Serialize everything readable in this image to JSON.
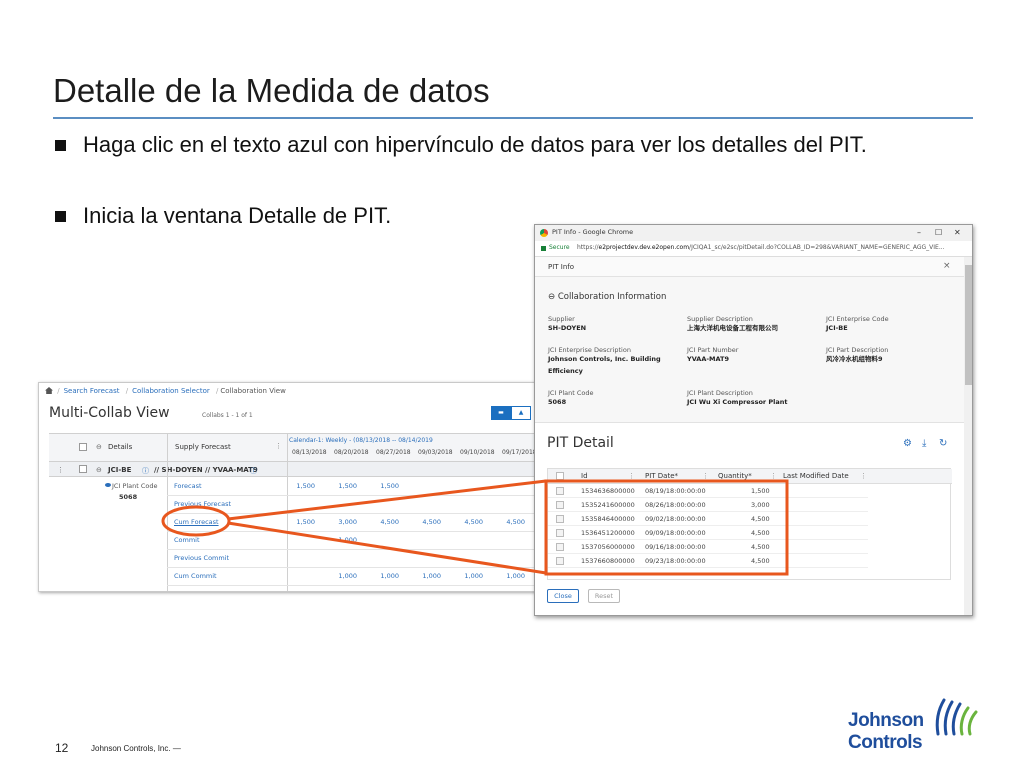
{
  "slide": {
    "title": "Detalle de la Medida de datos",
    "bullets": [
      "Haga clic en el texto azul con hipervínculo de datos para ver los detalles del PIT.",
      "Inicia la ventana Detalle de PIT."
    ],
    "page_number": "12",
    "footer_company": "Johnson Controls, Inc. —",
    "logo": {
      "line1": "Johnson",
      "line2": "Controls",
      "color": "#1f4e9c"
    }
  },
  "multi_collab": {
    "breadcrumbs": [
      "Search Forecast",
      "Collaboration Selector",
      "Collaboration View"
    ],
    "title": "Multi-Collab View",
    "collabs_count": "Collabs 1 - 1 of 1",
    "header": {
      "details": "Details",
      "supply_forecast": "Supply Forecast",
      "calendar": "Calendar-1: Weekly - (08/13/2018 -- 08/14/2019",
      "dates": [
        "08/13/2018",
        "08/20/2018",
        "08/27/2018",
        "09/03/2018",
        "09/10/2018",
        "09/17/2018"
      ]
    },
    "group": {
      "enterprise": "JCI-BE",
      "path": "// SH-DOYEN // YVAA-MAT9"
    },
    "plant": {
      "label": "JCI Plant Code",
      "code": "5068"
    },
    "rows": [
      {
        "name": "Forecast",
        "values": [
          "1,500",
          "1,500",
          "1,500",
          "",
          "",
          ""
        ]
      },
      {
        "name": "Previous Forecast",
        "values": [
          "",
          "",
          "",
          "",
          "",
          ""
        ]
      },
      {
        "name": "Cum Forecast",
        "values": [
          "1,500",
          "3,000",
          "4,500",
          "4,500",
          "4,500",
          "4,500"
        ]
      },
      {
        "name": "Commit",
        "values": [
          "",
          "1,000",
          "",
          "",
          "",
          ""
        ]
      },
      {
        "name": "Previous Commit",
        "values": [
          "",
          "",
          "",
          "",
          "",
          ""
        ]
      },
      {
        "name": "Cum Commit",
        "values": [
          "",
          "1,000",
          "1,000",
          "1,000",
          "1,000",
          "1,000"
        ]
      }
    ],
    "accent": "#1b6fc0"
  },
  "pit_window": {
    "tab_title": "PIT Info - Google Chrome",
    "secure_label": "Secure",
    "url_prefix": "https://",
    "url_domain": "e2projectdev.dev.e2open.com",
    "url_path": "/JCIQA1_sc/e2sc/pitDetail.do?COLLAB_ID=298&VARIANT_NAME=GENERIC_AGG_VIE...",
    "dialog_title": "PIT Info",
    "section": "Collaboration Information",
    "fields": [
      {
        "label": "Supplier",
        "value": "SH-DOYEN"
      },
      {
        "label": "Supplier Description",
        "value": "上海大洋机电设备工程有限公司"
      },
      {
        "label": "JCI Enterprise Code",
        "value": "JCI-BE"
      },
      {
        "label": "JCI Enterprise Description",
        "value": "Johnson Controls, Inc. Building Efficiency"
      },
      {
        "label": "JCI Part Number",
        "value": "YVAA-MAT9"
      },
      {
        "label": "JCI Part Description",
        "value": "风冷冷水机组物料9"
      },
      {
        "label": "JCI Plant Code",
        "value": "5068"
      },
      {
        "label": "JCI Plant Description",
        "value": "JCI Wu Xi Compressor Plant"
      }
    ],
    "detail_title": "PIT Detail",
    "columns": [
      "Id",
      "PIT Date*",
      "Quantity*",
      "Last Modified Date"
    ],
    "rows": [
      {
        "id": "1534636800000",
        "date": "08/19/18:00:00:00",
        "qty": "1,500"
      },
      {
        "id": "1535241600000",
        "date": "08/26/18:00:00:00",
        "qty": "3,000"
      },
      {
        "id": "1535846400000",
        "date": "09/02/18:00:00:00",
        "qty": "4,500"
      },
      {
        "id": "1536451200000",
        "date": "09/09/18:00:00:00",
        "qty": "4,500"
      },
      {
        "id": "1537056000000",
        "date": "09/16/18:00:00:00",
        "qty": "4,500"
      },
      {
        "id": "1537660800000",
        "date": "09/23/18:00:00:00",
        "qty": "4,500"
      }
    ],
    "buttons": {
      "close": "Close",
      "reset": "Reset"
    }
  },
  "annotation_color": "#e8571e"
}
